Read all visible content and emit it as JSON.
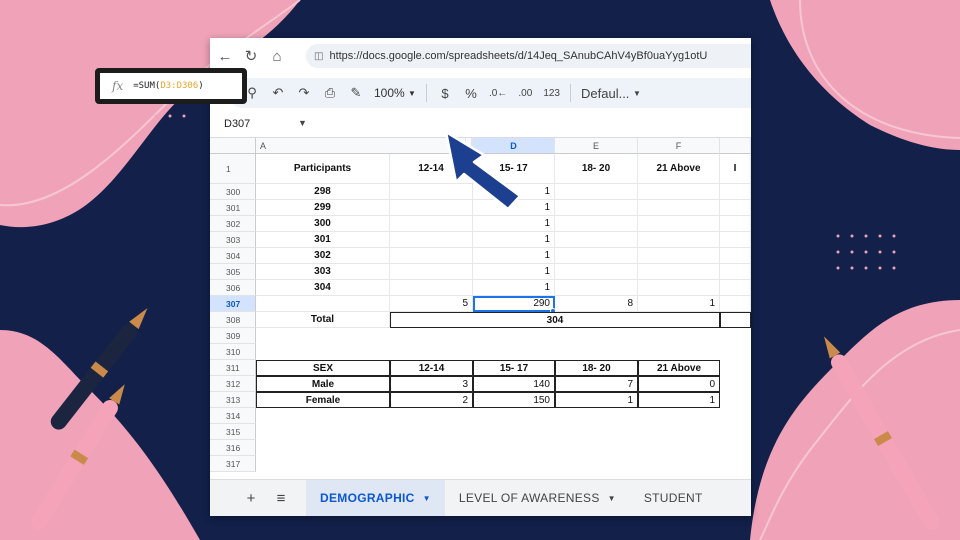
{
  "browser": {
    "back_icon": "arrow-left-icon",
    "url": "https://docs.google.com/spreadsheets/d/14Jeq_SAnubCAhV4yBf0uaYyg1otU"
  },
  "toolbar": {
    "zoom": "100%",
    "currency": "$",
    "percent": "%",
    "dec_decrease": ".0←",
    "dec_increase": ".00",
    "number_format": "123",
    "font": "Defaul..."
  },
  "formula_bar": {
    "cell_ref": "D307",
    "fx": "fx",
    "formula_prefix": "=SUM(",
    "formula_range": "D3:D306",
    "formula_suffix": ")"
  },
  "columns": [
    "A",
    "D",
    "E",
    "F"
  ],
  "header_row": {
    "num": "1",
    "participants": "Participants",
    "c": "12-14",
    "d": "15- 17",
    "e": "18- 20",
    "f": "21 Above",
    "g": "I"
  },
  "rows": [
    {
      "num": "300",
      "b": "298",
      "d": "1"
    },
    {
      "num": "301",
      "b": "299",
      "d": "1"
    },
    {
      "num": "302",
      "b": "300",
      "d": "1"
    },
    {
      "num": "303",
      "b": "301",
      "d": "1"
    },
    {
      "num": "304",
      "b": "302",
      "d": "1"
    },
    {
      "num": "305",
      "b": "303",
      "d": "1"
    },
    {
      "num": "306",
      "b": "304",
      "d": "1"
    }
  ],
  "row307": {
    "num": "307",
    "c": "5",
    "d": "290",
    "e": "8",
    "f": "1"
  },
  "row308": {
    "num": "308",
    "label": "Total",
    "value": "304"
  },
  "empty_rows": [
    "309",
    "310"
  ],
  "sex_table": {
    "header": {
      "num": "311",
      "label": "SEX",
      "c": "12-14",
      "d": "15- 17",
      "e": "18- 20",
      "f": "21 Above"
    },
    "rows": [
      {
        "num": "312",
        "label": "Male",
        "c": "3",
        "d": "140",
        "e": "7",
        "f": "0"
      },
      {
        "num": "313",
        "label": "Female",
        "c": "2",
        "d": "150",
        "e": "1",
        "f": "1"
      }
    ]
  },
  "trailing_rows": [
    "314",
    "315",
    "316",
    "317"
  ],
  "tabs": {
    "add": "+",
    "all_sheets": "≡",
    "items": [
      {
        "label": "DEMOGRAPHIC",
        "active": true
      },
      {
        "label": "LEVEL OF AWARENESS",
        "active": false
      },
      {
        "label": "STUDENT",
        "active": false
      }
    ]
  },
  "colors": {
    "background_navy": "#12204a",
    "pink": "#f0a3b8",
    "arrow_blue": "#1d3f8f",
    "formula_range": "#e8a52c",
    "selection_blue": "#1a73e8"
  }
}
